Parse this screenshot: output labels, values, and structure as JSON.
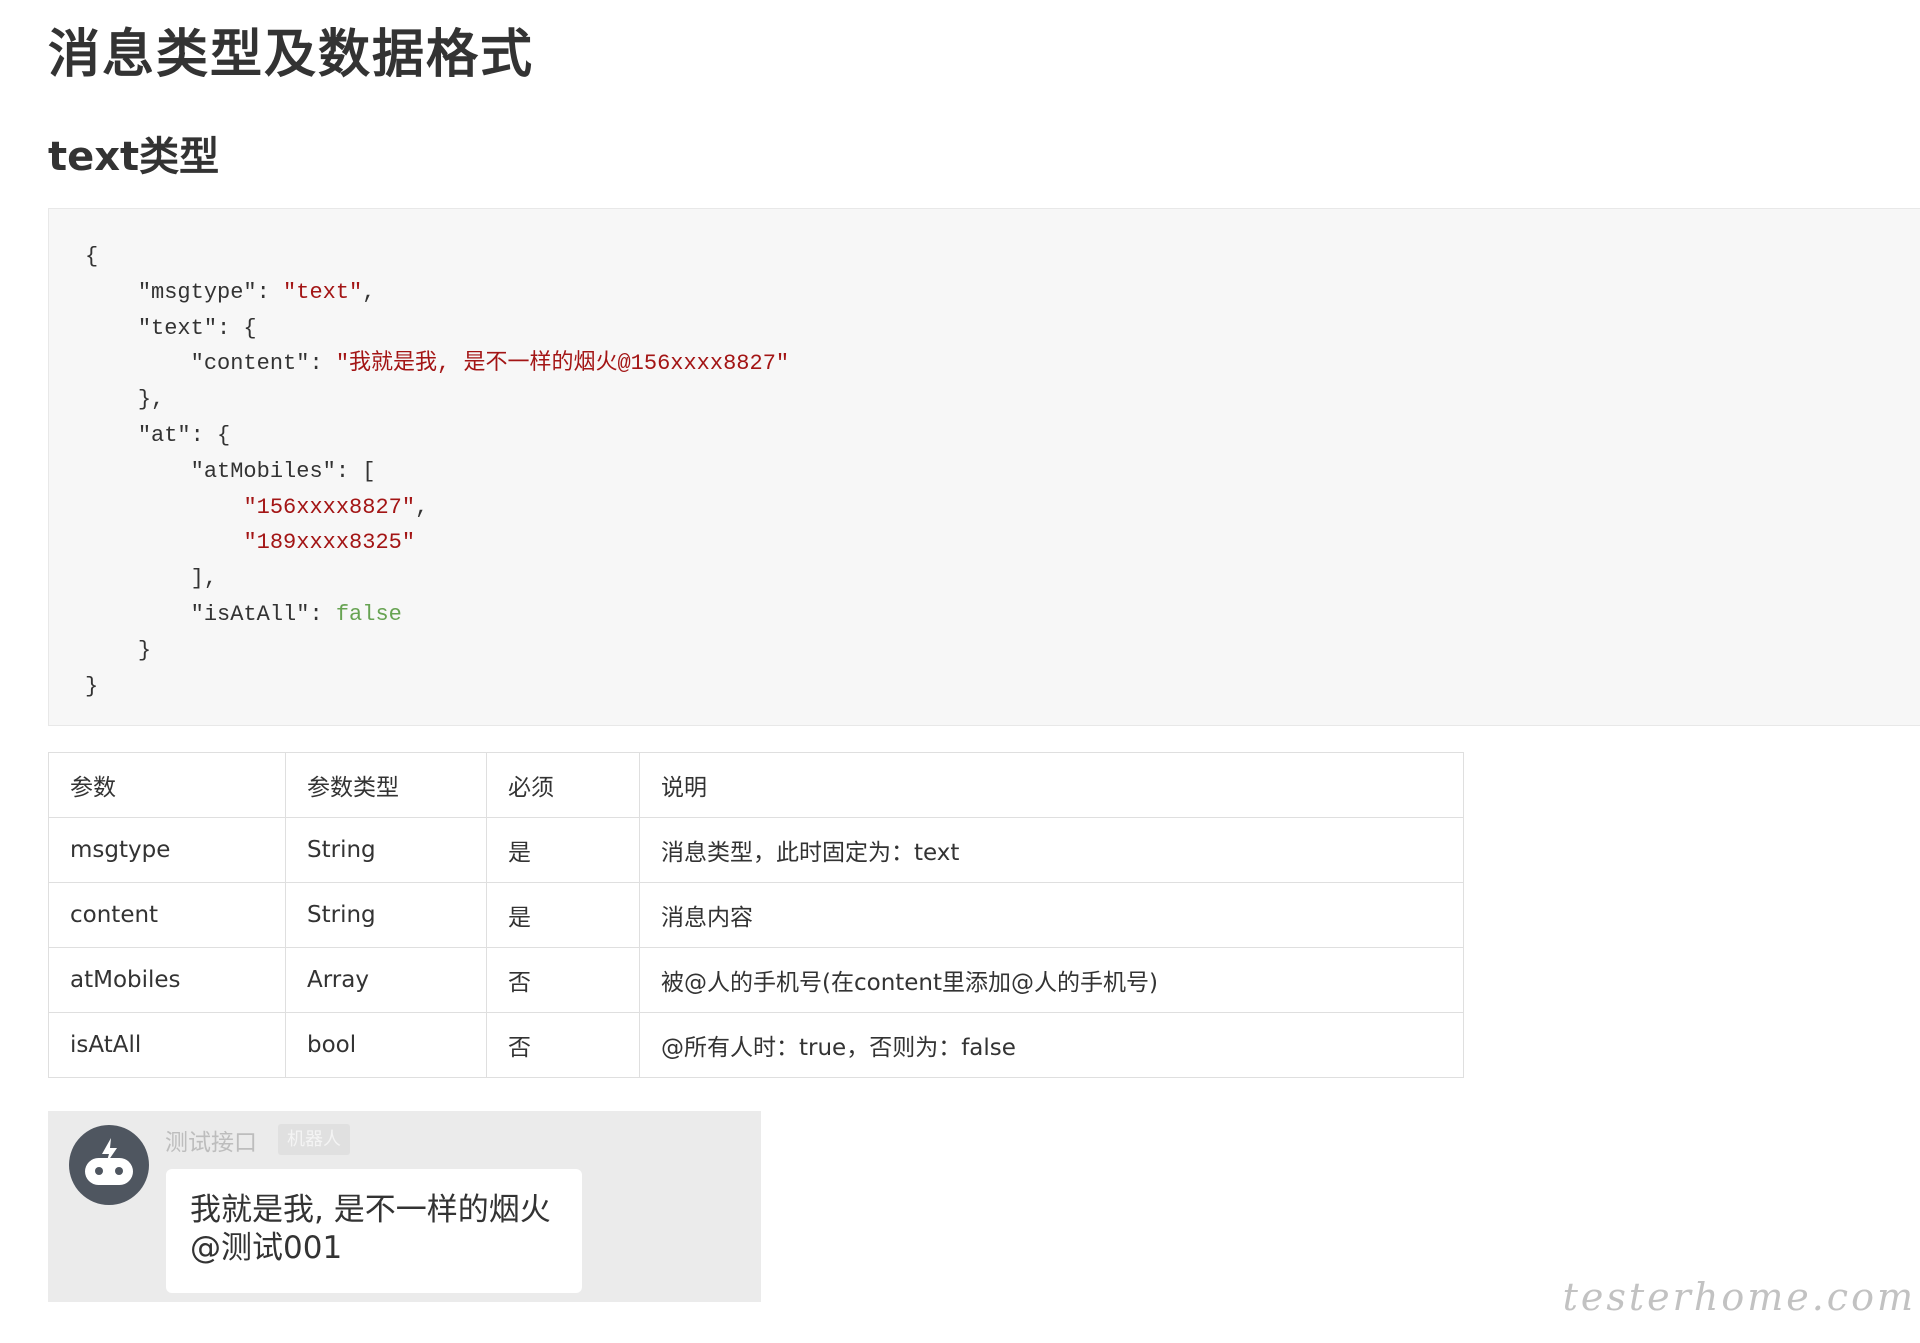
{
  "document": {
    "title": "消息类型及数据格式",
    "section_title": "text类型"
  },
  "code": {
    "line1": "{",
    "l2_key": "\"msgtype\": ",
    "l2_val": "\"text\"",
    "l2_tail": ",",
    "l3": "\"text\": {",
    "l4_key": "\"content\": ",
    "l4_val": "\"我就是我, 是不一样的烟火@156xxxx8827\"",
    "l5": "},",
    "l6": "\"at\": {",
    "l7": "\"atMobiles\": [",
    "l8_val": "\"156xxxx8827\"",
    "l8_tail": ",",
    "l9_val": "\"189xxxx8325\"",
    "l10": "],",
    "l11_key": "\"isAtAll\": ",
    "l11_val": "false",
    "l12": "}",
    "l13": "}"
  },
  "table": {
    "headers": [
      "参数",
      "参数类型",
      "必须",
      "说明"
    ],
    "rows": [
      [
        "msgtype",
        "String",
        "是",
        "消息类型，此时固定为：text"
      ],
      [
        "content",
        "String",
        "是",
        "消息内容"
      ],
      [
        "atMobiles",
        "Array",
        "否",
        "被@人的手机号(在content里添加@人的手机号)"
      ],
      [
        "isAtAll",
        "bool",
        "否",
        "@所有人时：true，否则为：false"
      ]
    ]
  },
  "chat": {
    "sender": "测试接口",
    "tag": "机器人",
    "message_line1": "我就是我, 是不一样的烟火",
    "message_line2": "@测试001"
  },
  "watermark": "testerhome.com"
}
